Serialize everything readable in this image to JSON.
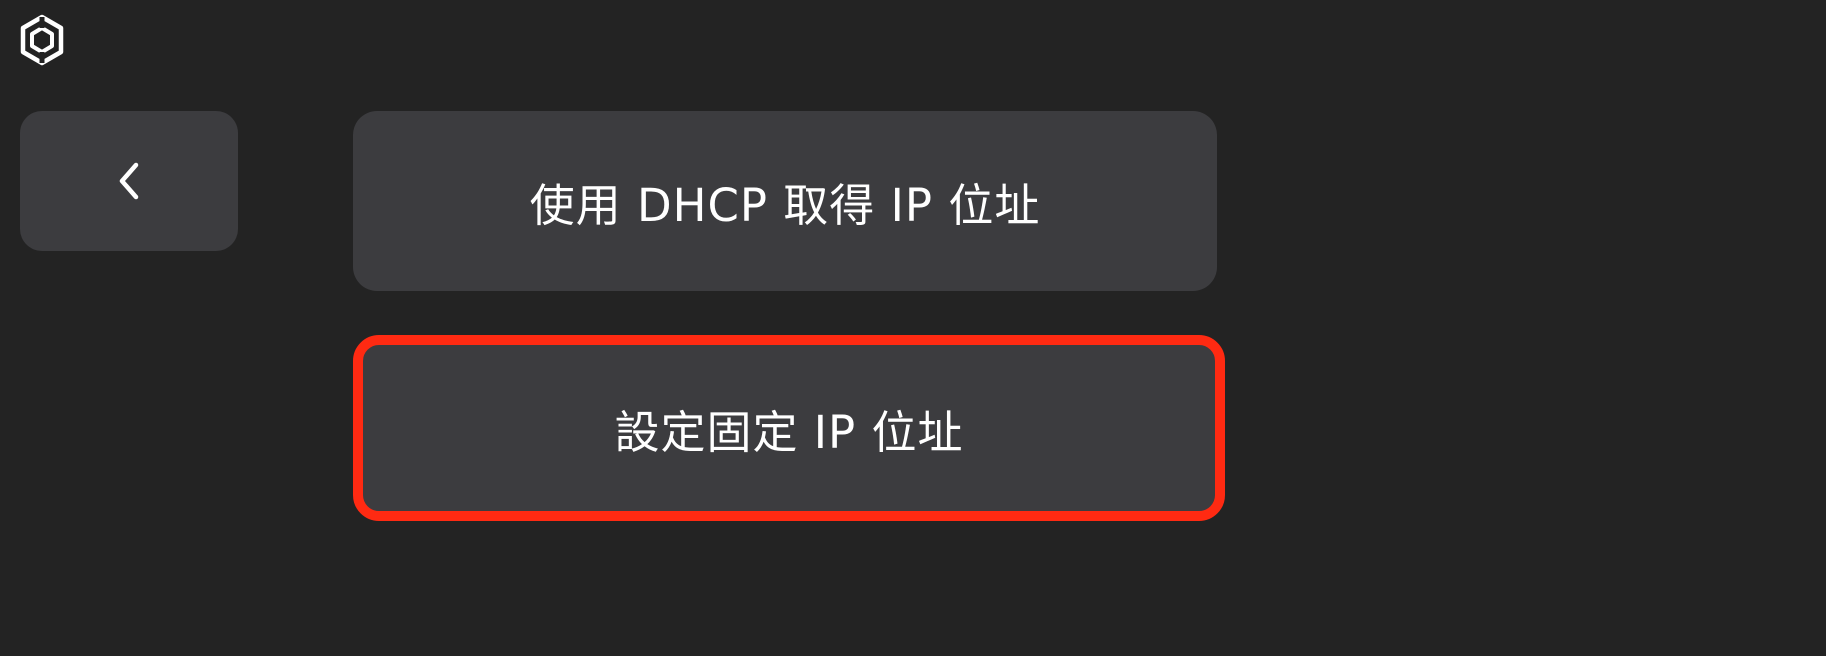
{
  "header": {
    "logo_icon": "hexagon-logo-icon"
  },
  "navigation": {
    "back_icon": "chevron-left-icon"
  },
  "options": {
    "dhcp_label": "使用 DHCP 取得 IP 位址",
    "static_label": "設定固定 IP 位址",
    "selected": "static"
  },
  "colors": {
    "background": "#232323",
    "button": "#3c3c3f",
    "highlight": "#ff2a12",
    "text": "#ffffff"
  }
}
